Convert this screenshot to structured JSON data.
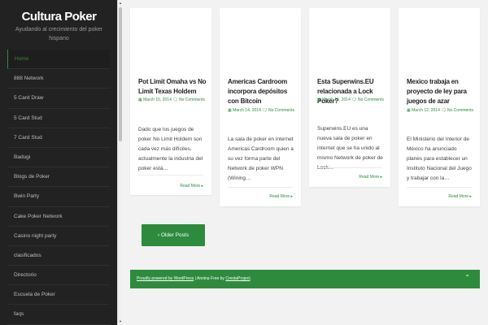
{
  "site": {
    "title": "Cultura Poker",
    "description": "Ayudando al crecimiento del poker hispano"
  },
  "menu": [
    "Home",
    "888 Network",
    "5 Card Draw",
    "5 Card Stud",
    "7 Card Stud",
    "Badugi",
    "Blogs de Poker",
    "Bwin Party",
    "Cake Poker Network",
    "Casino night party",
    "clasificados",
    "Directorio",
    "Escuela de Poker",
    "faqs"
  ],
  "posts": [
    {
      "title": "Pot Limit Omaha vs No Limit Texas Holdem",
      "date": "March 15, 2014",
      "comments": "No Comments",
      "excerpt": "Dado que los juegos de poker No Limit Holdem son cada vez más difíciles, actualmente la industria del poker está…",
      "read_more": "Read More"
    },
    {
      "title": "Americas Cardroom incorpora depósitos con Bitcoin",
      "date": "March 14, 2014",
      "comments": "No Comments",
      "excerpt": "La sala de poker en internet Americas Cardroom quien a su vez forma parte del Network de poker WPN (Wining…",
      "read_more": "Read More"
    },
    {
      "title": "Esta Superwins.EU relacionada a Lock Poker?",
      "date": "March 13, 2014",
      "comments": "No Comments",
      "excerpt": "Superwins.EU es una nueva sala de poker en internet que se ha unido al mismo Network de poker de Lock…",
      "read_more": "Read More"
    },
    {
      "title": "Mexico trabaja en proyecto de ley para juegos de azar",
      "date": "March 12, 2014",
      "comments": "No Comments",
      "excerpt": "El Ministerio del Interior de México ha anunciado planes para establecer un Instituto Nacional del Juego y trabajar con la…",
      "read_more": "Read More"
    }
  ],
  "pagination": {
    "older_label": "‹ Older Posts"
  },
  "footer": {
    "powered": "Proudly powered by WordPress",
    "separator": "| Annina Free by",
    "theme_author": "CrestaProject",
    "period": "."
  },
  "icons": {
    "calendar": "calendar-icon",
    "comments": "comments-icon",
    "read_more_arrow": "caret-right-icon",
    "back_to_top": "chevron-up-icon"
  },
  "colors": {
    "accent": "#2e8b3e",
    "sidebar_bg": "#222222",
    "page_bg": "#f2f2f2"
  }
}
